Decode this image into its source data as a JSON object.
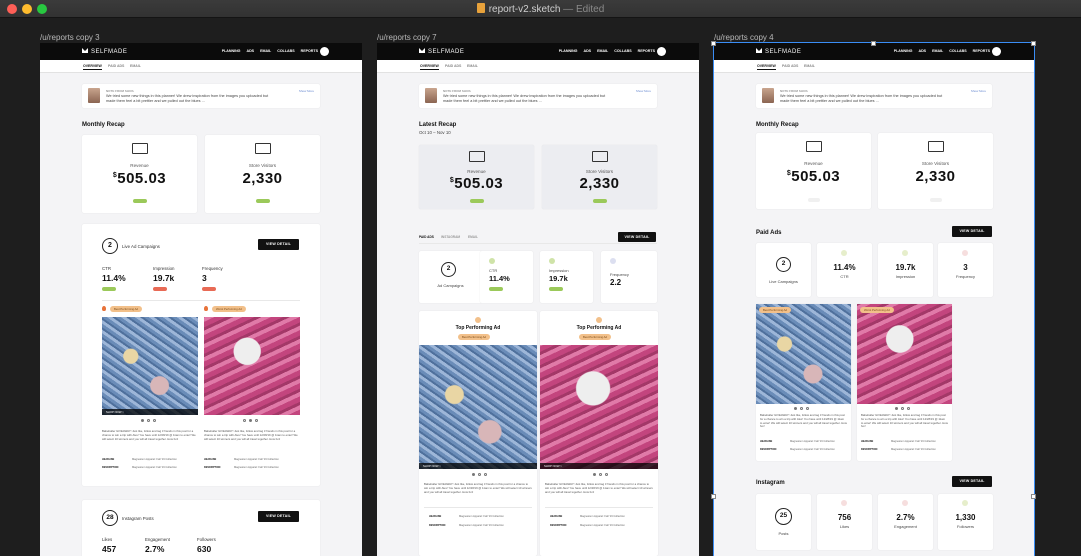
{
  "window": {
    "title": "report-v2.sketch",
    "status": "— Edited"
  },
  "artboards": [
    {
      "label": "/u/reports copy 3",
      "brand": "SELFMADE",
      "nav_links": [
        "PLANNING",
        "ADS",
        "EMAIL",
        "COLLABS",
        "REPORTS"
      ],
      "subnav": [
        "OVERVIEW",
        "PAID ADS",
        "EMAIL"
      ],
      "notice": {
        "from": "NOTE FROM SHIVA",
        "text": "We tried some new things in this planner! We drew inspiration from the images you uploaded but made them feel a bit prettier and we pulled out the blues ...",
        "more": "Show More"
      },
      "section_title": "Monthly Recap",
      "revenue": {
        "label": "Revenue",
        "currency": "$",
        "value": "505.03"
      },
      "visitors": {
        "label": "Store Visitors",
        "value": "2,330"
      },
      "campaigns": {
        "count": "2",
        "label": "Live Ad Campaigns",
        "button": "VIEW DETAIL",
        "kpis": [
          {
            "label": "CTR",
            "value": "11.4%",
            "status": "green"
          },
          {
            "label": "Impression",
            "value": "19.7k",
            "status": "red"
          },
          {
            "label": "Frequency",
            "value": "3",
            "status": "red"
          }
        ],
        "badges": [
          "Best Performing Ad",
          "Worst Performing Ad"
        ],
        "shop_label": "SHOP NOW >",
        "caption": "Babeballer GIVEAWAY! Just like, follow and tag 3 friends in this post for a chance to win a trip with Alex! You have until 12/28/19 @ 11am to enter! We will select 10 winners and you will all travel together. How fun!",
        "meta": [
          {
            "key": "HEADLINE",
            "value": "Magnesium Apparel: Fall '19 Collection"
          },
          {
            "key": "DESCRIPTION",
            "value": "Magnesium Apparel: Fall '19 Collection"
          }
        ]
      },
      "instagram": {
        "count": "28",
        "label": "Instagram Posts",
        "button": "VIEW DETAIL",
        "kpis": [
          {
            "label": "Likes",
            "value": "457"
          },
          {
            "label": "Engagement",
            "value": "2.7%"
          },
          {
            "label": "Followers",
            "value": "630"
          }
        ]
      }
    },
    {
      "label": "/u/reports copy 7",
      "brand": "SELFMADE",
      "nav_links": [
        "PLANNING",
        "ADS",
        "EMAIL",
        "COLLABS",
        "REPORTS"
      ],
      "subnav": [
        "OVERVIEW",
        "PAID ADS",
        "EMAIL"
      ],
      "notice": {
        "from": "NOTE FROM SHIVA",
        "text": "We tried some new things in this planner! We drew inspiration from the images you uploaded but made them feel a bit prettier and we pulled out the blues ...",
        "more": "Show More"
      },
      "section_title": "Latest Recap",
      "date_range": "Oct 10 – Nov 10",
      "revenue": {
        "label": "Revenue",
        "currency": "$",
        "value": "505.03"
      },
      "visitors": {
        "label": "Store Visitors",
        "value": "2,330"
      },
      "tabs": [
        "PAID ADS",
        "INSTAGRAM",
        "EMAIL"
      ],
      "button": "VIEW DETAIL",
      "campaigns": {
        "count": "2",
        "label": "Ad Campaigns"
      },
      "kpis": [
        {
          "label": "CTR",
          "value": "11.4%"
        },
        {
          "label": "Impression",
          "value": "19.7k"
        },
        {
          "label": "Frequency",
          "value": "2.2"
        }
      ],
      "top_ad_title": "Top Performing Ad",
      "top_ad_badge": "Best Performing Ad",
      "shop_label": "SHOP NOW >",
      "caption": "Babeballer GIVEAWAY! Just like, follow and tag 3 friends in this post for a chance to win a trip with Alex! You have until 12/28/19 @ 11am to enter! We will select 10 winners and you will all travel together. How fun!",
      "meta": [
        {
          "key": "HEADLINE",
          "value": "Magnesium Apparel: Fall '19 Collection"
        },
        {
          "key": "DESCRIPTION",
          "value": "Magnesium Apparel: Fall '19 Collection"
        }
      ]
    },
    {
      "label": "/u/reports copy 4",
      "brand": "SELFMADE",
      "nav_links": [
        "PLANNING",
        "ADS",
        "EMAIL",
        "COLLABS",
        "REPORTS"
      ],
      "subnav": [
        "OVERVIEW",
        "PAID ADS",
        "EMAIL"
      ],
      "notice": {
        "from": "NOTE FROM SHIVA",
        "text": "We tried some new things in this planner! We drew inspiration from the images you uploaded but made them feel a bit prettier and we pulled out the blues ...",
        "more": "Show More"
      },
      "section_title": "Monthly Recap",
      "revenue": {
        "label": "Revenue",
        "currency": "$",
        "value": "505.03"
      },
      "visitors": {
        "label": "Store Visitors",
        "value": "2,330"
      },
      "paid_ads": {
        "title": "Paid Ads",
        "button": "VIEW DETAIL",
        "count": "2",
        "count_label": "Live Campaigns",
        "kpis": [
          {
            "label": "CTR",
            "value": "11.4%"
          },
          {
            "label": "Impression",
            "value": "19.7k"
          },
          {
            "label": "Frequency",
            "value": "3"
          }
        ],
        "badges": [
          "Best Performing Ad",
          "Worst Performing Ad"
        ],
        "caption": "Babeballer GIVEAWAY! Just like, follow and tag 3 friends in this post for a chance to win a trip with Alex! You have until 12/28/19 @ 11am to enter! We will select 10 winners and you will all travel together. How fun!",
        "meta": [
          {
            "key": "HEADLINE",
            "value": "Magnesium Apparel: Fall '19 Collection"
          },
          {
            "key": "DESCRIPTION",
            "value": "Magnesium Apparel: Fall '19 Collection"
          }
        ]
      },
      "instagram": {
        "title": "Instagram",
        "button": "VIEW DETAIL",
        "count": "25",
        "count_label": "Posts",
        "kpis": [
          {
            "label": "Likes",
            "value": "756"
          },
          {
            "label": "Engagement",
            "value": "2.7%"
          },
          {
            "label": "Followers",
            "value": "1,330"
          }
        ]
      }
    }
  ],
  "colors": {
    "positive": "#9bc95a",
    "negative": "#e86a55",
    "badge": "#f2c08a",
    "selection": "#3a8df5"
  }
}
